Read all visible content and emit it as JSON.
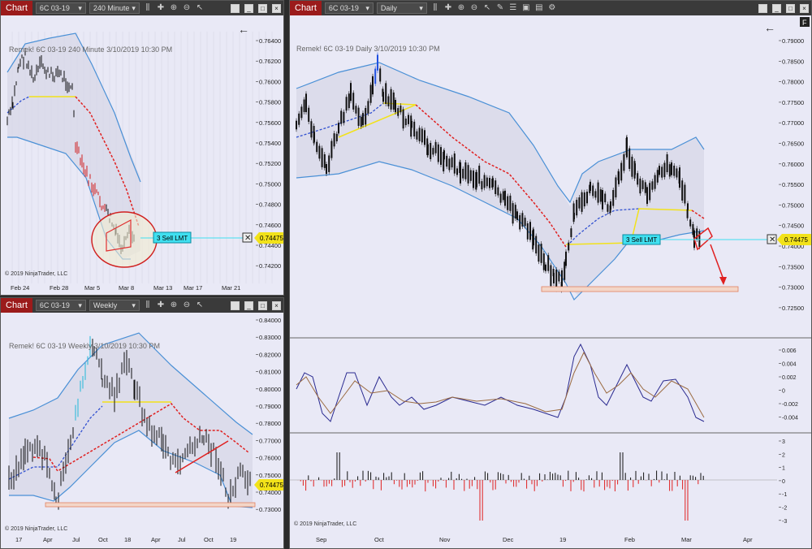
{
  "win1": {
    "chart_label": "Chart",
    "instrument": "6C 03-19",
    "interval": "240 Minute",
    "title": "Remek!  6C 03-19  240 Minute  3/10/2019 10:30 PM",
    "copyright": "© 2019 NinjaTrader, LLC",
    "price_ticks": [
      "0.76400",
      "0.76200",
      "0.76000",
      "0.75800",
      "0.75600",
      "0.75400",
      "0.75200",
      "0.75000",
      "0.74800",
      "0.74600",
      "0.74400",
      "0.74200"
    ],
    "date_ticks": [
      "Feb 24",
      "Feb 28",
      "Mar 5",
      "Mar 8",
      "Mar 13",
      "Mar 17",
      "Mar 21"
    ],
    "order_label": "3  Sell LMT",
    "price_marker": "0.74475"
  },
  "win2": {
    "chart_label": "Chart",
    "instrument": "6C 03-19",
    "interval": "Weekly",
    "title": "Remek!  6C 03-19  Weekly  3/10/2019 10:30 PM",
    "copyright": "© 2019 NinjaTrader, LLC",
    "price_ticks": [
      "0.84000",
      "0.83000",
      "0.82000",
      "0.81000",
      "0.80000",
      "0.79000",
      "0.78000",
      "0.77000",
      "0.76000",
      "0.75000",
      "0.74000",
      "0.73000"
    ],
    "date_ticks": [
      "17",
      "Apr",
      "Jul",
      "Oct",
      "18",
      "Apr",
      "Jul",
      "Oct",
      "19"
    ],
    "price_marker": "0.74475"
  },
  "win3": {
    "chart_label": "Chart",
    "instrument": "6C 03-19",
    "interval": "Daily",
    "title": "Remek!  6C 03-19  Daily  3/10/2019 10:30 PM",
    "copyright": "© 2019 NinjaTrader, LLC",
    "price_ticks": [
      "0.79000",
      "0.78500",
      "0.78000",
      "0.77500",
      "0.77000",
      "0.76500",
      "0.76000",
      "0.75500",
      "0.75000",
      "0.74500",
      "0.74000",
      "0.73500",
      "0.73000",
      "0.72500"
    ],
    "osc_ticks": [
      "0.006",
      "0.004",
      "0.002",
      "0",
      "-0.002",
      "-0.004"
    ],
    "hist_ticks": [
      "3",
      "2",
      "1",
      "0",
      "-1",
      "-2",
      "-3"
    ],
    "date_ticks": [
      "Sep",
      "Oct",
      "Nov",
      "Dec",
      "19",
      "Feb",
      "Mar",
      "Apr"
    ],
    "order_label": "3  Sell LMT",
    "price_marker": "0.74475",
    "f_badge": "F"
  },
  "colors": {
    "up_band": "#4a90d6",
    "bar": "#111111",
    "ma_red": "#e02020",
    "ma_yellow": "#f2e21a",
    "ma_blue": "#3050d0",
    "marker": "#f2e21a",
    "order": "#40e0f0"
  }
}
